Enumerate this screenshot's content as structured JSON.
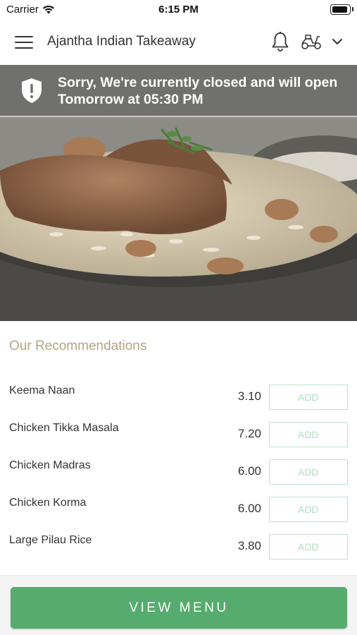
{
  "status_bar": {
    "carrier": "Carrier",
    "time": "6:15 PM",
    "battery_level": 0.9
  },
  "header": {
    "title": "Ajantha Indian Takeaway",
    "icons": [
      "menu-icon",
      "bell-icon",
      "scooter-icon",
      "chevron-down-icon"
    ]
  },
  "banner": {
    "text": "Sorry, We're currently closed and will open Tomorrow at 05:30 PM",
    "icon": "shield-alert-icon"
  },
  "recommendations": {
    "title": "Our Recommendations",
    "add_label": "ADD",
    "items": [
      {
        "name": "Keema Naan",
        "price": "3.10"
      },
      {
        "name": "Chicken Tikka Masala",
        "price": "7.20"
      },
      {
        "name": "Chicken Madras",
        "price": "6.00"
      },
      {
        "name": "Chicken Korma",
        "price": "6.00"
      },
      {
        "name": "Large Pilau Rice",
        "price": "3.80"
      }
    ]
  },
  "footer": {
    "view_menu_label": "VIEW MENU"
  },
  "colors": {
    "accent_green": "#55ac6e",
    "add_border": "#b9e3c8",
    "section_title": "#b3a682",
    "banner_bg": "#6e6e6c"
  }
}
